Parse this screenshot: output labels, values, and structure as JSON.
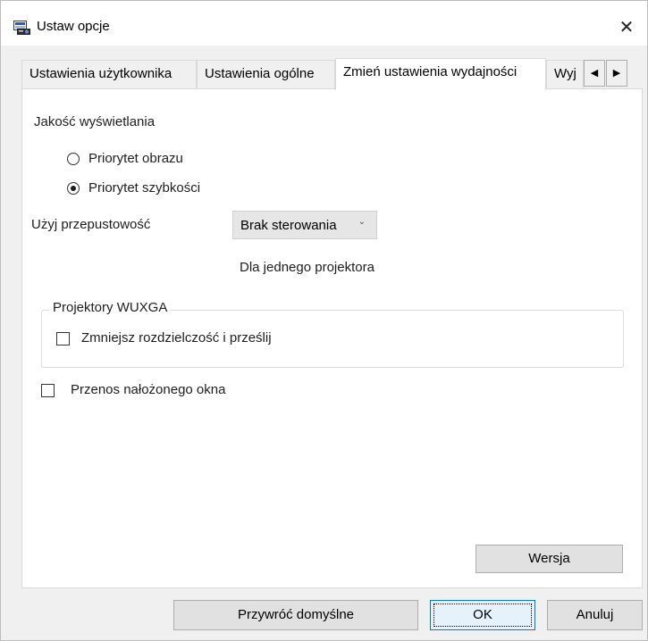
{
  "window": {
    "title": "Ustaw opcje",
    "close_symbol": "✕"
  },
  "tabs": [
    {
      "label": "Ustawienia użytkownika",
      "active": false
    },
    {
      "label": "Ustawienia ogólne",
      "active": false
    },
    {
      "label": "Zmień ustawienia wydajności",
      "active": true
    },
    {
      "label": "Wyj",
      "active": false
    }
  ],
  "tab_scroll": {
    "left": "◀",
    "right": "▶"
  },
  "panel": {
    "display_quality_label": "Jakość wyświetlania",
    "radio_image_priority": {
      "label": "Priorytet obrazu",
      "checked": false
    },
    "radio_speed_priority": {
      "label": "Priorytet szybkości",
      "checked": true
    },
    "bandwidth_label": "Użyj przepustowość",
    "bandwidth_select": {
      "value": "Brak sterowania",
      "chevron": "⌄"
    },
    "bandwidth_note": "Dla jednego projektora",
    "wuxga_group_title": "Projektory WUXGA",
    "reduce_resolution_checkbox": {
      "label": "Zmniejsz rozdzielczość i prześlij",
      "checked": false
    },
    "overlay_window_checkbox": {
      "label": "Przenos nałożonego okna",
      "checked": false
    },
    "version_button": "Wersja"
  },
  "footer": {
    "restore_defaults_button": "Przywróć domyślne",
    "ok_button": "OK",
    "cancel_button": "Anuluj"
  },
  "colors": {
    "window_bg": "#f0f0f0",
    "panel_bg": "#ffffff",
    "default_button_border": "#0078d7"
  }
}
